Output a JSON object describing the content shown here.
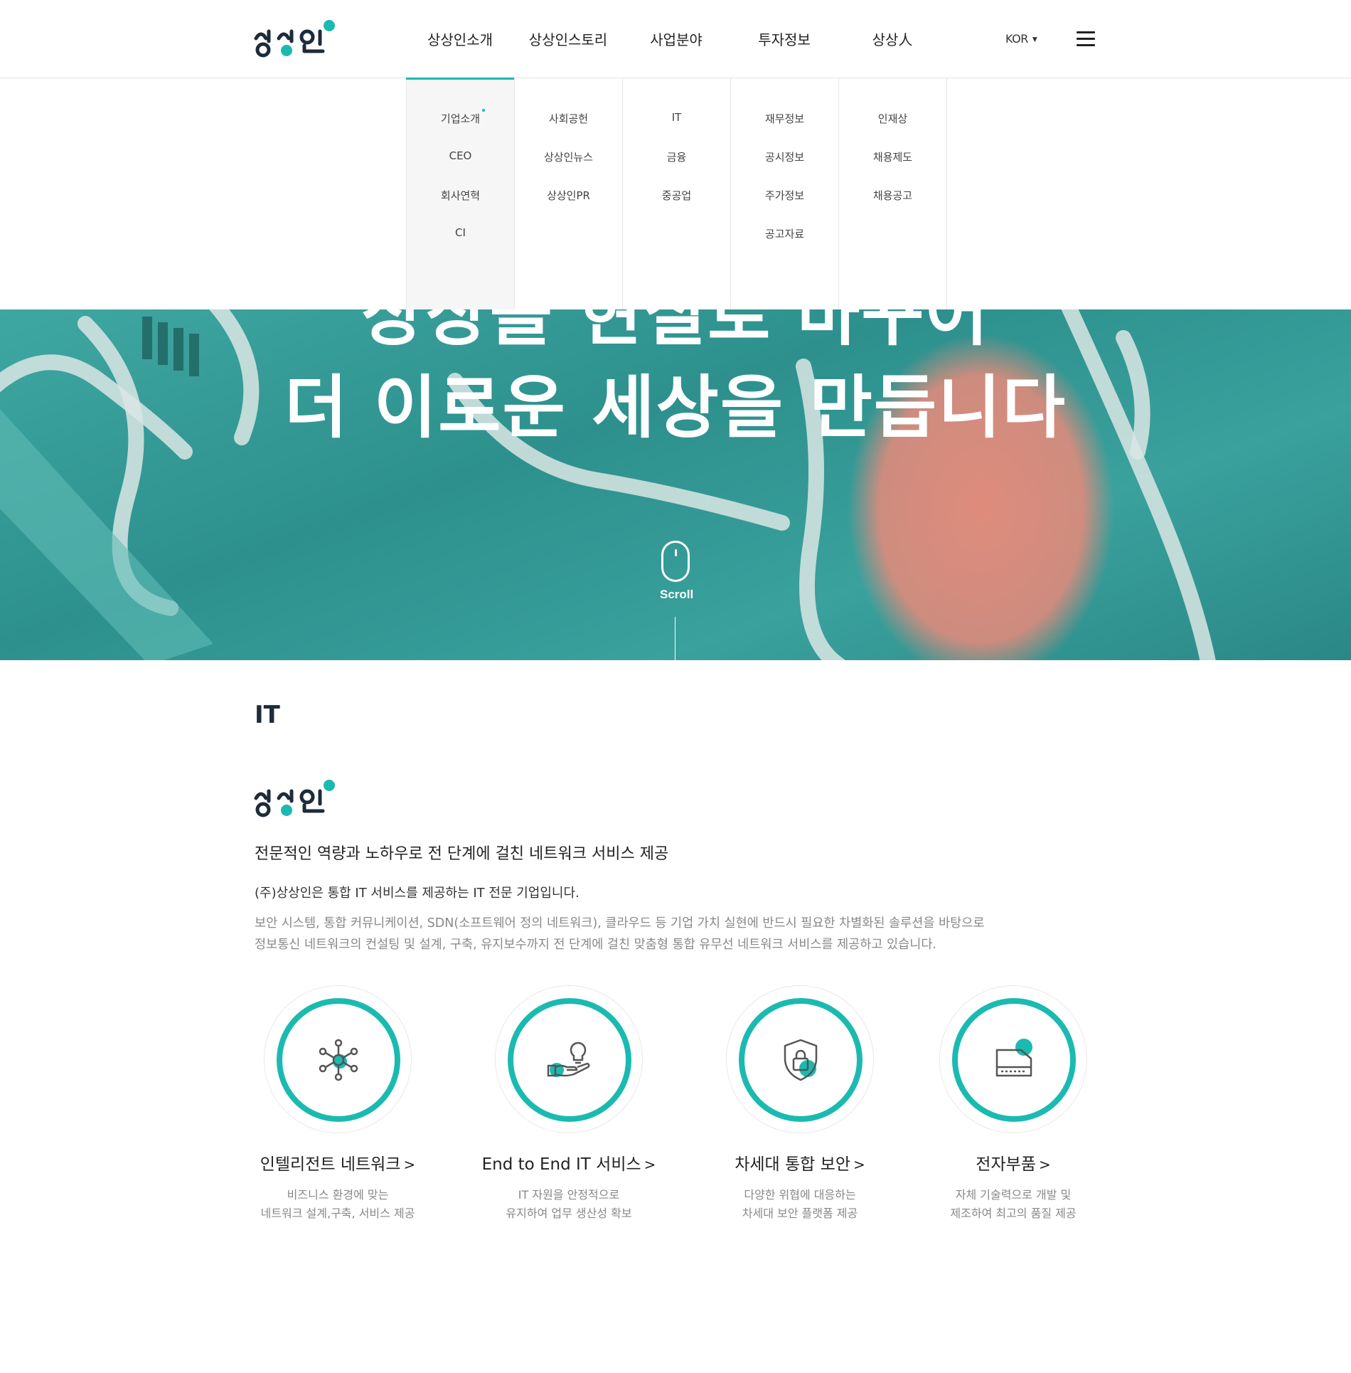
{
  "header": {
    "logo_text": "상상인",
    "nav": [
      "상상인소개",
      "상상인스토리",
      "사업분야",
      "투자정보",
      "상상人"
    ],
    "language": "KOR"
  },
  "mega_menu": [
    {
      "items": [
        "기업소개",
        "CEO",
        "회사연혁",
        "CI"
      ]
    },
    {
      "items": [
        "사회공헌",
        "상상인뉴스",
        "상상인PR"
      ]
    },
    {
      "items": [
        "IT",
        "금융",
        "중공업"
      ]
    },
    {
      "items": [
        "재무정보",
        "공시정보",
        "주가정보",
        "공고자료"
      ]
    },
    {
      "items": [
        "인재상",
        "채용제도",
        "채용공고"
      ]
    }
  ],
  "hero": {
    "line1": "상상을 현실로 바꾸어",
    "line2": "더 이로운 세상을 만듭니다",
    "scroll_label": "Scroll"
  },
  "section": {
    "title": "IT",
    "logo_text": "상상인",
    "headline": "전문적인 역량과 노하우로 전 단계에 걸친 네트워크 서비스 제공",
    "lead": "(주)상상인은 통합 IT 서비스를 제공하는 IT 전문 기업입니다.",
    "desc_line1": "보안 시스템, 통합 커뮤니케이션, SDN(소프트웨어 정의 네트워크), 클라우드 등 기업 가치 실현에 반드시 필요한 차별화된 솔루션을 바탕으로",
    "desc_line2": "정보통신 네트워크의 컨설팅 및 설계, 구축, 유지보수까지 전 단계에 걸친 맞춤형 통합 유무선 네트워크 서비스를 제공하고 있습니다."
  },
  "services": [
    {
      "title": "인텔리전트 네트워크",
      "desc1": "비즈니스 환경에 맞는",
      "desc2": "네트워크 설계,구축, 서비스 제공",
      "icon": "network-icon"
    },
    {
      "title": "End to End IT 서비스",
      "desc1": "IT 자원을 안정적으로",
      "desc2": "유지하여 업무 생산성 확보",
      "icon": "hand-lightbulb-icon"
    },
    {
      "title": "차세대 통합 보안",
      "desc1": "다양한 위협에 대응하는",
      "desc2": "차세대 보안 플랫폼 제공",
      "icon": "shield-lock-icon"
    },
    {
      "title": "전자부품",
      "desc1": "자체 기술력으로 개발 및",
      "desc2": "제조하여 최고의 품질 제공",
      "icon": "device-icon"
    }
  ],
  "colors": {
    "accent": "#1bbab1",
    "dark": "#1d2b3a",
    "hero_teal": "#3aa19d",
    "hero_coral": "#e88a7a"
  }
}
